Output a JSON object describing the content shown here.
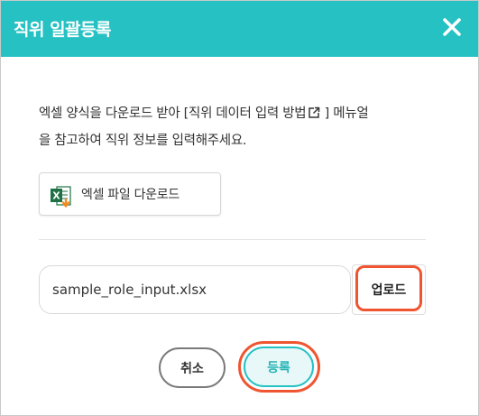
{
  "dialog": {
    "title": "직위 일괄등록",
    "close_icon": "close-icon",
    "header_color": "#26c1c3"
  },
  "description": {
    "line1_text": "엑셀 양식을 다운로드 받아 [직위 데이터 입력 방법",
    "external_link_icon": "external-link-icon",
    "line1_suffix": " ] 메뉴얼",
    "line2_text": "을 참고하여 직위 정보를 입력해주세요."
  },
  "excel_download": {
    "icon": "excel-download-icon",
    "label": "엑셀 파일 다운로드"
  },
  "file_upload": {
    "filename_value": "sample_role_input.xlsx",
    "upload_label": "업로드"
  },
  "footer": {
    "cancel_label": "취소",
    "register_label": "등록"
  },
  "colors": {
    "accent": "#26c1c3",
    "highlight": "#ef5530"
  }
}
